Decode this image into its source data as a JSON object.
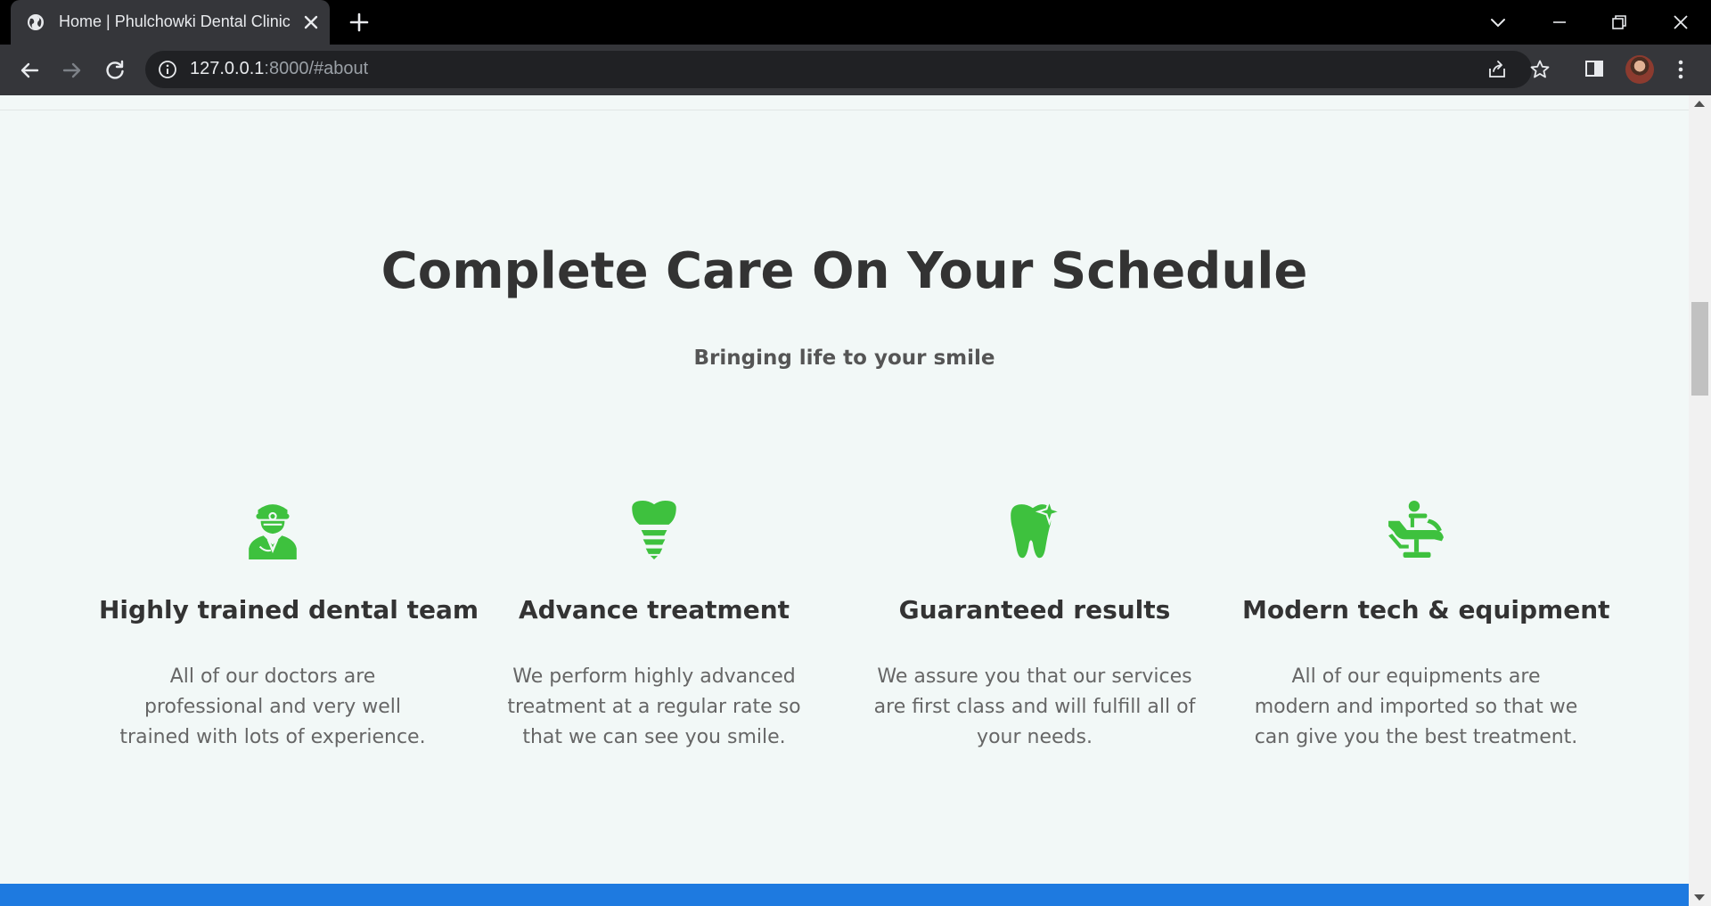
{
  "browser": {
    "tab_title": "Home | Phulchowki Dental Clinic",
    "url_host": "127.0.0.1",
    "url_rest": ":8000/#about"
  },
  "about": {
    "title": "Complete Care On Your Schedule",
    "subtitle": "Bringing life to your smile",
    "features": [
      {
        "icon": "dentist-icon",
        "title": "Highly trained dental team",
        "description": "All of our doctors are professional and very well trained with lots of experience."
      },
      {
        "icon": "tooth-implant-icon",
        "title": "Advance treatment",
        "description": "We perform highly advanced treatment at a regular rate so that we can see you smile."
      },
      {
        "icon": "sparkling-tooth-icon",
        "title": "Guaranteed results",
        "description": "We assure you that our services are first class and will fulfill all of your needs."
      },
      {
        "icon": "dental-chair-icon",
        "title": "Modern tech & equipment",
        "description": "All of our equipments are modern and imported so that we can give you the best treatment."
      }
    ]
  },
  "colors": {
    "accent_green": "#3ec13e",
    "page_background": "#f2f8f7",
    "footer_blue": "#1e7ae0",
    "heading": "#333333",
    "body_text": "#666666"
  }
}
